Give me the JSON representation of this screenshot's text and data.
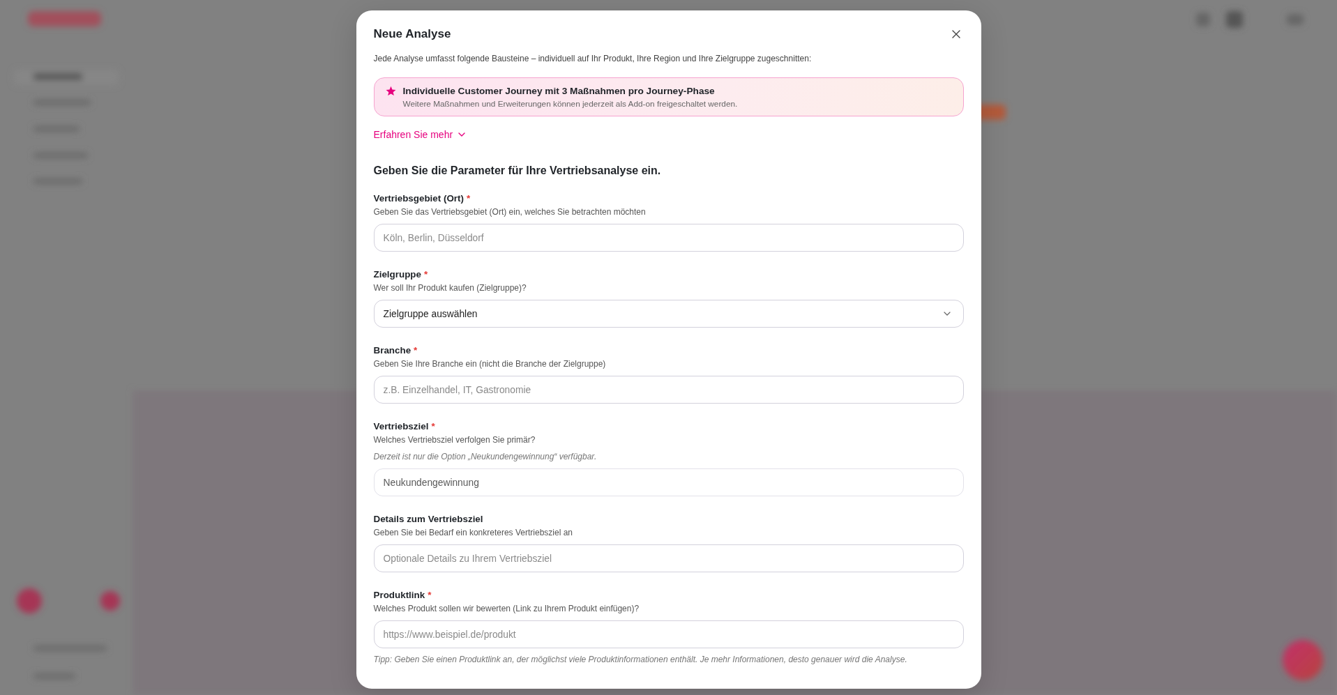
{
  "dialog": {
    "title": "Neue Analyse",
    "intro": "Jede Analyse umfasst folgende Bausteine – individuell auf Ihr Produkt, Ihre Region und Ihre Zielgruppe zugeschnitten:",
    "highlight": {
      "title": "Individuelle Customer Journey mit 3 Maßnahmen pro Journey-Phase",
      "text": "Weitere Maßnahmen und Erweiterungen können jederzeit als Add-on freigeschaltet werden."
    },
    "learn_more": {
      "label": "Erfahren Sie mehr",
      "expanded": false
    },
    "section_heading": "Geben Sie die Parameter für Ihre Vertriebsanalyse ein.",
    "fields": [
      {
        "kind": "text",
        "label": "Vertriebsgebiet (Ort)",
        "required_mark": "*",
        "hint": "Geben Sie das Vertriebsgebiet (Ort) ein, welches Sie betrachten möchten",
        "placeholder": "Köln, Berlin, Düsseldorf",
        "disabled": false
      },
      {
        "kind": "select",
        "label": "Zielgruppe",
        "required_mark": "*",
        "hint": "Wer soll Ihr Produkt kaufen (Zielgruppe)?",
        "value": "Zielgruppe auswählen",
        "disabled": false
      },
      {
        "kind": "text",
        "label": "Branche",
        "required_mark": "*",
        "hint": "Geben Sie Ihre Branche ein (nicht die Branche der Zielgruppe)",
        "placeholder": "z.B. Einzelhandel, IT, Gastronomie",
        "disabled": false
      },
      {
        "kind": "text",
        "label": "Vertriebsziel",
        "required_mark": "*",
        "hint": "Welches Vertriebsziel verfolgen Sie primär?",
        "note": "Derzeit ist nur die Option „Neukundengewinnung“ verfügbar.",
        "value": "Neukundengewinnung",
        "disabled": true
      },
      {
        "kind": "text",
        "label": "Details zum Vertriebsziel",
        "hint": "Geben Sie bei Bedarf ein konkreteres Vertriebsziel an",
        "placeholder": "Optionale Details zu Ihrem Vertriebsziel",
        "disabled": false
      },
      {
        "kind": "text",
        "label": "Produktlink",
        "required_mark": "*",
        "hint": "Welches Produkt sollen wir bewerten (Link zu Ihrem Produkt einfügen)?",
        "placeholder": "https://www.beispiel.de/produkt",
        "tip": "Tipp: Geben Sie einen Produktlink an, der möglichst viele Produktinformationen enthält. Je mehr Informationen, desto genauer wird die Analyse.",
        "disabled": false
      }
    ]
  }
}
